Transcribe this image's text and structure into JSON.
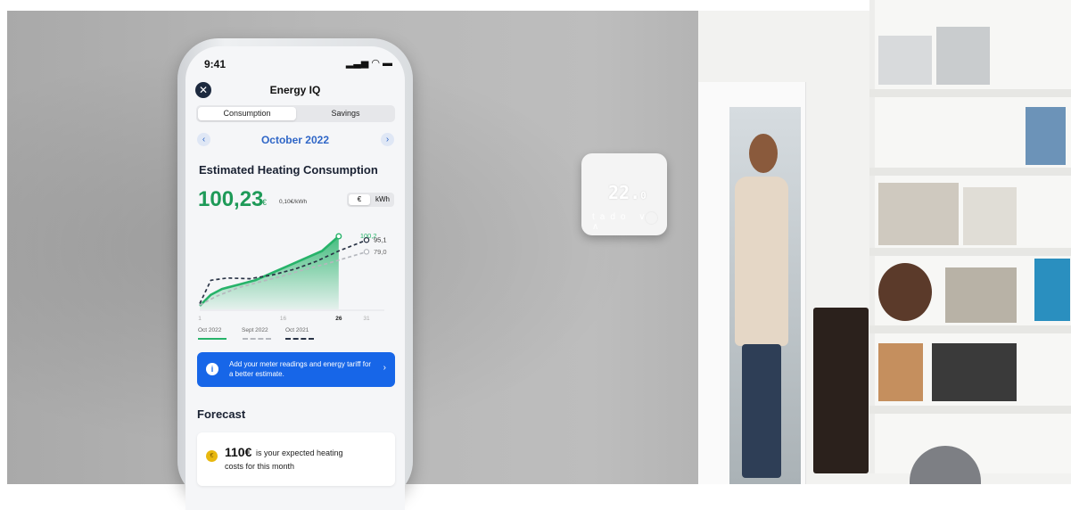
{
  "status_bar": {
    "time": "9:41",
    "icons": "▂▃▅ ◠ ▬"
  },
  "app": {
    "title": "Energy IQ",
    "close_glyph": "✕"
  },
  "tabs": [
    {
      "label": "Consumption",
      "active": true
    },
    {
      "label": "Savings",
      "active": false
    }
  ],
  "period": {
    "month": "October 2022",
    "prev_glyph": "‹",
    "next_glyph": "›"
  },
  "consumption": {
    "title": "Estimated Heating Consumption",
    "amount": "100,23",
    "currency": "€",
    "rate": "0,10€/kWh",
    "units": [
      {
        "label": "€",
        "active": true
      },
      {
        "label": "kWh",
        "active": false
      }
    ]
  },
  "chart_data": {
    "type": "line",
    "x_ticks": [
      "1",
      "16",
      "26",
      "31"
    ],
    "x_tick_values": [
      1,
      16,
      26,
      31
    ],
    "highlight_tick": "26",
    "xlim": [
      1,
      31
    ],
    "ylim": [
      0,
      110
    ],
    "series": [
      {
        "name": "Oct 2022",
        "style": "area",
        "color": "#27b36a",
        "end_label": "100,2",
        "x": [
          1,
          3,
          5,
          8,
          11,
          14,
          17,
          20,
          23,
          26
        ],
        "y": [
          5,
          20,
          28,
          34,
          40,
          50,
          60,
          70,
          80,
          100.2
        ]
      },
      {
        "name": "Sept 2022",
        "style": "dashed",
        "color": "#b5b8be",
        "end_label": "79,0",
        "x": [
          1,
          4,
          8,
          12,
          16,
          20,
          24,
          28,
          31
        ],
        "y": [
          6,
          18,
          30,
          38,
          46,
          55,
          63,
          72,
          79
        ]
      },
      {
        "name": "Oct 2021",
        "style": "dashed",
        "color": "#2a3446",
        "end_label": "95,1",
        "x": [
          1,
          3,
          6,
          10,
          14,
          18,
          22,
          26,
          29,
          31
        ],
        "y": [
          8,
          40,
          43,
          42,
          47,
          55,
          66,
          80,
          89,
          95.1
        ]
      }
    ]
  },
  "banner": {
    "text": "Add your meter readings and energy tariff for a better estimate.",
    "icon_glyph": "i",
    "chevron_glyph": "›"
  },
  "forecast": {
    "title": "Forecast",
    "amount": "110€",
    "text_line1": "is your expected heating",
    "text_line2": "costs for this month",
    "coin_glyph": "€"
  },
  "thermostat": {
    "temp": "22.",
    "temp_decimal": "0",
    "controls": "tado ∨ ∧"
  }
}
